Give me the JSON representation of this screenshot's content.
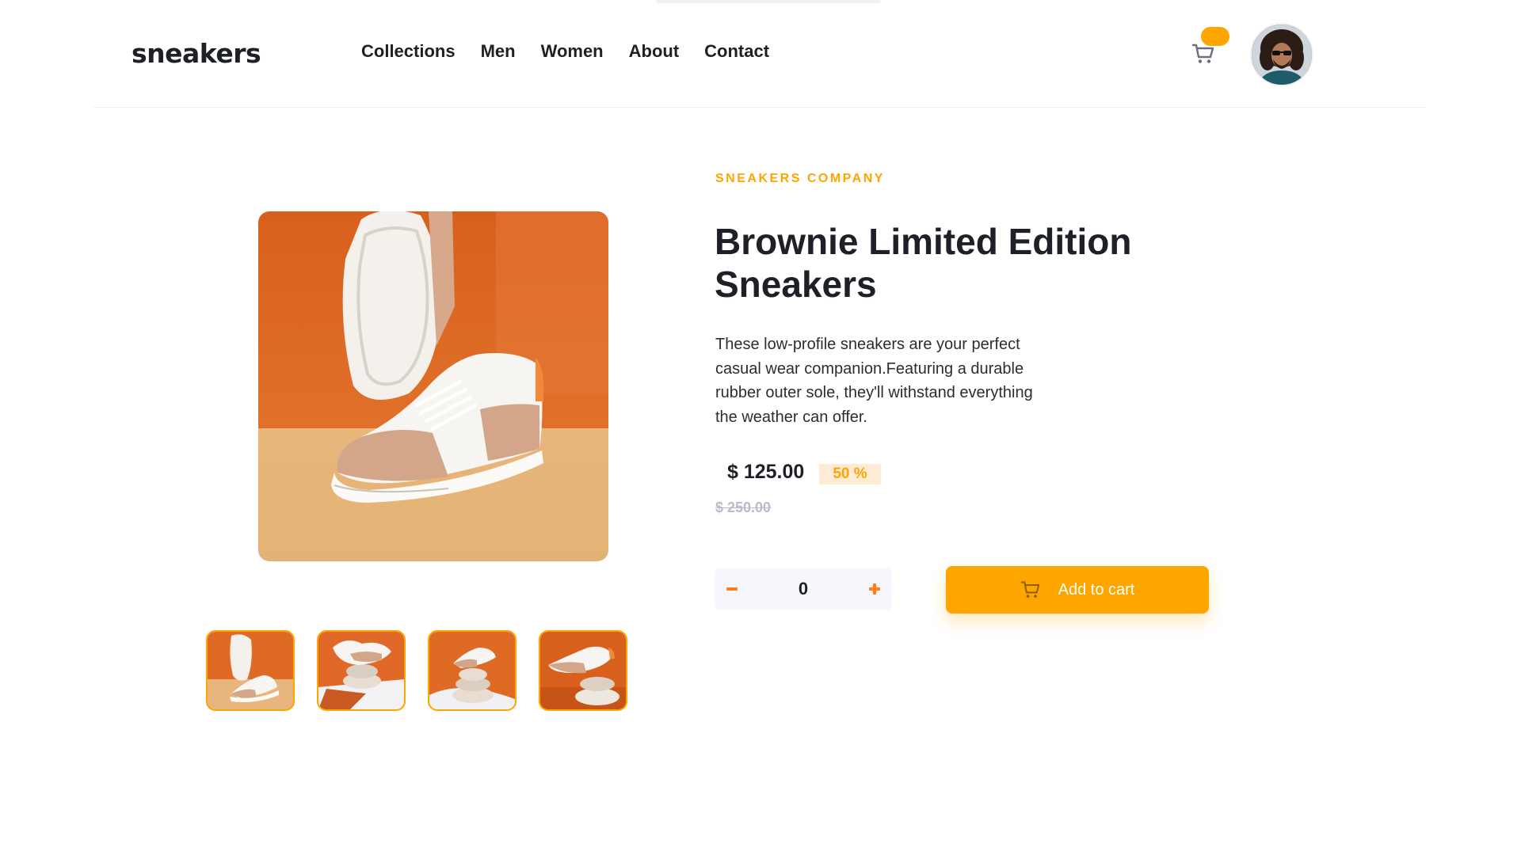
{
  "header": {
    "logo": "sneakers",
    "nav": [
      "Collections",
      "Men",
      "Women",
      "About",
      "Contact"
    ],
    "cart_icon": "cart-icon",
    "cart_count": "",
    "avatar_icon": "user-avatar"
  },
  "gallery": {
    "main_alt": "sneaker-product-image",
    "thumbnails": [
      "thumbnail-1",
      "thumbnail-2",
      "thumbnail-3",
      "thumbnail-4"
    ]
  },
  "product": {
    "company": "SNEAKERS COMPANY",
    "title": "Brownie Limited Edition Sneakers",
    "description": "These low-profile sneakers are your perfect casual wear companion.Featuring a durable rubber outer sole, they'll withstand everything the weather can offer.",
    "price": "$ 125.00",
    "discount": "50 %",
    "old_price": "$ 250.00",
    "quantity": "0",
    "add_to_cart": "Add to cart"
  },
  "colors": {
    "accent": "#ffa500",
    "accent_pale": "#fdebd6",
    "text_dark": "#1d2026",
    "muted": "#b6bcc8"
  }
}
